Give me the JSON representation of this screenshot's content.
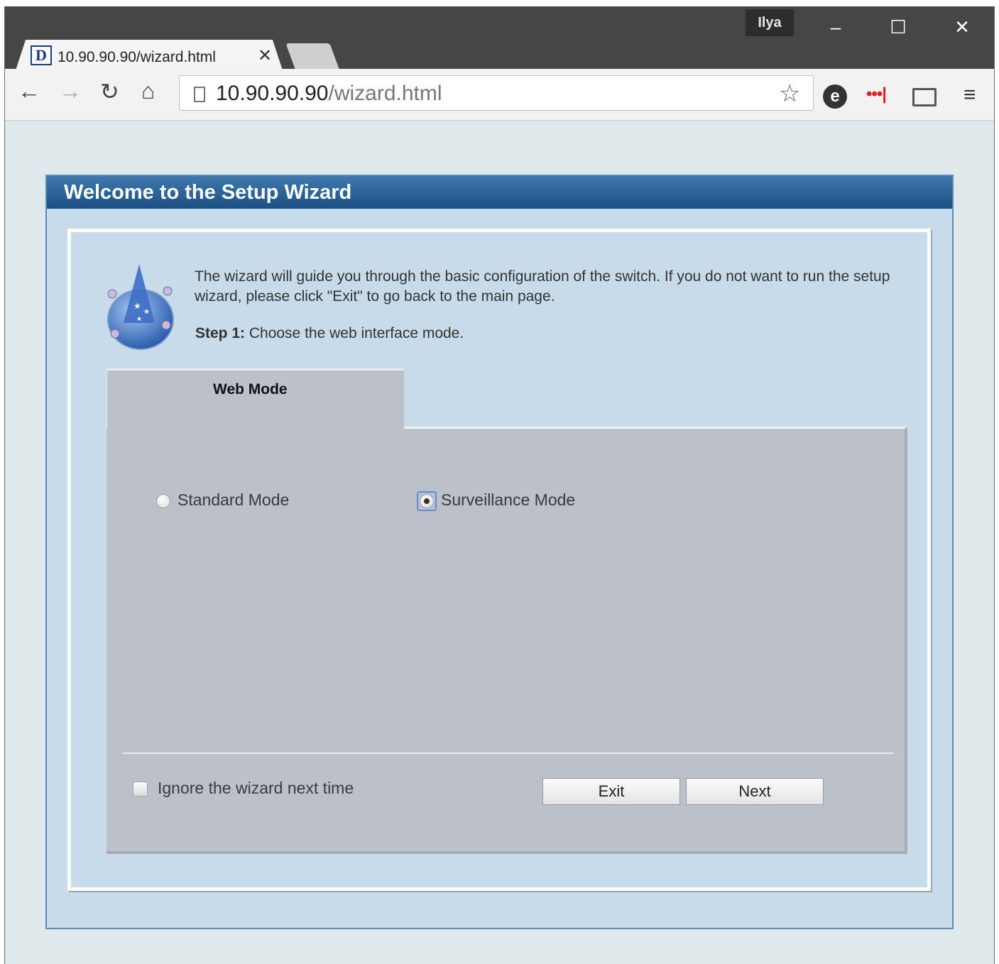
{
  "browser": {
    "user_name": "Ilya",
    "tab": {
      "title": "10.90.90.90/wizard.html",
      "favicon_letter": "D"
    },
    "address": {
      "host": "10.90.90.90",
      "path": "/wizard.html"
    },
    "icons": {
      "back": "arrow-left-icon",
      "forward": "arrow-right-icon",
      "reload": "reload-icon",
      "home": "home-icon",
      "bookmark": "star-icon",
      "extension": "e-extension-icon",
      "lastpass": "dots-icon",
      "cast": "cast-icon",
      "menu": "hamburger-menu-icon"
    },
    "window_controls": {
      "minimize": "–",
      "maximize": "☐",
      "close": "✕"
    }
  },
  "wizard": {
    "title": "Welcome to the Setup Wizard",
    "intro": "The wizard will guide you through the basic configuration of the switch. If you do not want to run the setup wizard, please click \"Exit\" to go back to the main page.",
    "step_label": "Step 1:",
    "step_text": " Choose the web interface mode.",
    "tab_label": "Web Mode",
    "options": [
      {
        "label": "Standard Mode",
        "selected": false
      },
      {
        "label": "Surveillance Mode",
        "selected": true
      }
    ],
    "ignore_label": "Ignore the wizard next time",
    "ignore_checked": false,
    "exit_label": "Exit",
    "next_label": "Next"
  },
  "colors": {
    "header_top": "#3f79ad",
    "header_bottom": "#1c4f84",
    "panel_bg": "#c7dbea",
    "tab_bg": "#bcc1c9"
  }
}
